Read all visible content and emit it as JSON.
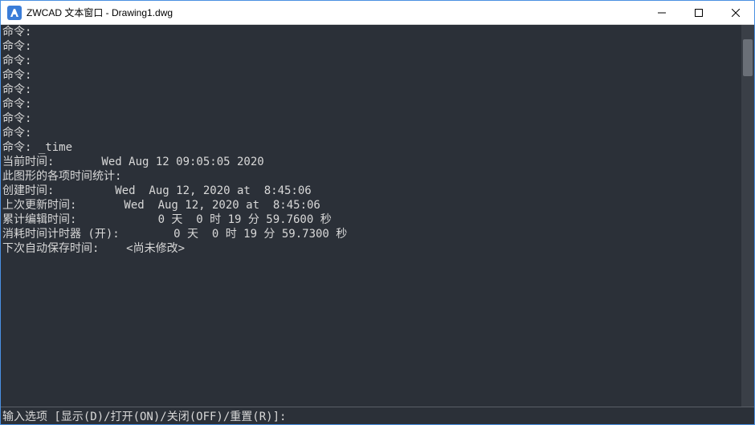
{
  "titlebar": {
    "title": "ZWCAD 文本窗口 - Drawing1.dwg"
  },
  "terminal": {
    "lines": [
      "命令:",
      "命令:",
      "命令:",
      "命令:",
      "命令:",
      "命令:",
      "命令:",
      "命令:",
      "命令: _time",
      "当前时间:       Wed Aug 12 09:05:05 2020",
      "此图形的各项时间统计:",
      "创建时间:         Wed  Aug 12, 2020 at  8:45:06",
      "上次更新时间:       Wed  Aug 12, 2020 at  8:45:06",
      "累计编辑时间:            0 天  0 时 19 分 59.7600 秒",
      "消耗时间计时器 (开):        0 天  0 时 19 分 59.7300 秒",
      "下次自动保存时间:    <尚未修改>"
    ]
  },
  "commandbar": {
    "prompt": "输入选项 [显示(D)/打开(ON)/关闭(OFF)/重置(R)]:",
    "value": ""
  }
}
